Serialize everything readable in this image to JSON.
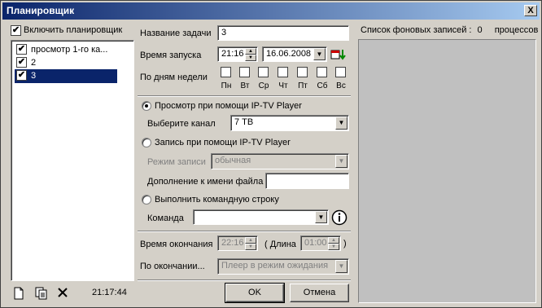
{
  "window": {
    "title": "Планировщик",
    "close": "X"
  },
  "scheduler": {
    "enable_label": "Включить планировщик",
    "tasks": [
      {
        "label": "просмотр 1-го ка...",
        "checked": true
      },
      {
        "label": "2",
        "checked": true
      },
      {
        "label": "3",
        "checked": true,
        "selected": true
      }
    ],
    "clock": "21:17:44"
  },
  "form": {
    "task_name_label": "Название задачи",
    "task_name_value": "3",
    "start_time_label": "Время запуска",
    "start_time_value": "21:16",
    "start_date_value": "16.06.2008",
    "weekdays_label": "По дням недели",
    "weekdays": [
      "Пн",
      "Вт",
      "Ср",
      "Чт",
      "Пт",
      "Сб",
      "Вс"
    ],
    "view_label": "Просмотр при помощи IP-TV Player",
    "channel_label": "Выберите канал",
    "channel_value": "7 ТВ",
    "record_label": "Запись при помощи IP-TV Player",
    "record_mode_label": "Режим записи",
    "record_mode_value": "обычная",
    "filename_suffix_label": "Дополнение к имени файла",
    "filename_suffix_value": "",
    "cmd_label": "Выполнить командную строку",
    "command_label": "Команда",
    "command_value": "",
    "end_time_label": "Время окончания",
    "end_time_value": "22:16",
    "duration_open": "( Длина",
    "duration_value": "01:00",
    "duration_close": ")",
    "after_label": "По окончании...",
    "after_value": "Плеер в режим ожидания"
  },
  "buttons": {
    "ok": "OK",
    "cancel": "Отмена"
  },
  "background": {
    "title": "Список фоновых записей :",
    "count": "0",
    "suffix": "процессов"
  },
  "colors": {
    "selection": "#0a246a",
    "title_gradient_start": "#0a246a",
    "face": "#d4d0c8"
  },
  "icons": [
    "new-document-icon",
    "copy-icon",
    "delete-icon",
    "calendar-icon",
    "info-icon"
  ]
}
